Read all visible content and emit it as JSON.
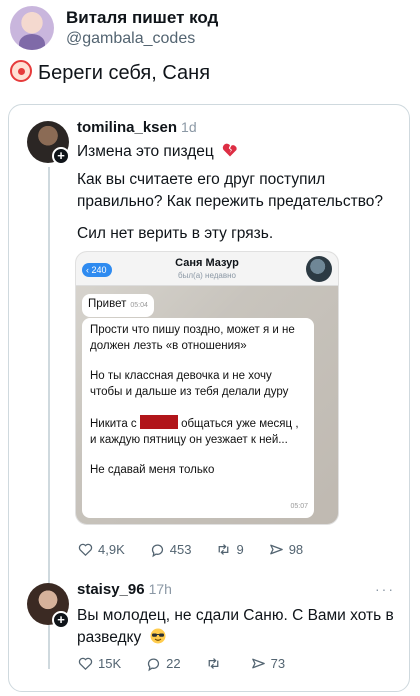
{
  "header": {
    "name": "Виталя пишет код",
    "handle": "@gambala_codes"
  },
  "post": {
    "text": "Береги себя, Саня"
  },
  "reply1": {
    "user": "tomilina_ksen",
    "ago": "1d",
    "line1": "Измена это пиздец",
    "line2": "Как вы считаете его друг поступил правильно? Как пережить предательство?",
    "line3": "Сил нет верить в эту грязь.",
    "screenshot": {
      "back_count": "240",
      "contact_name": "Саня Мазур",
      "contact_status": "был(а) недавно",
      "msg1": "Привет",
      "msg1_time": "05:04",
      "msg2_p1": "Прости что пишу поздно, может я и не должен лезть «в отношения»",
      "msg2_p2": "Но ты классная девочка и не хочу чтобы и дальше из тебя делали дуру",
      "msg2_p3a": "Никита с",
      "msg2_p3b": "общаться уже месяц , и каждую пятницу он уезжает к ней...",
      "msg2_p4": "Не сдавай меня только",
      "msg2_time": "05:07"
    },
    "actions": {
      "likes": "4,9K",
      "replies": "453",
      "reposts": "9",
      "views": "98"
    }
  },
  "reply2": {
    "user": "staisy_96",
    "ago": "17h",
    "text": "Вы молодец, не сдали Саню. С Вами хоть в разведку",
    "actions": {
      "likes": "15K",
      "replies": "22",
      "reposts": "",
      "views": "73"
    }
  },
  "icons": [
    "clown-icon",
    "broken-heart-icon",
    "sunglasses-emoji-icon",
    "heart-icon",
    "reply-icon",
    "repost-icon",
    "views-icon",
    "more-icon"
  ],
  "colors": {
    "accent": "#2f8bf0",
    "redaction": "#b1151a",
    "muted": "#536471"
  }
}
